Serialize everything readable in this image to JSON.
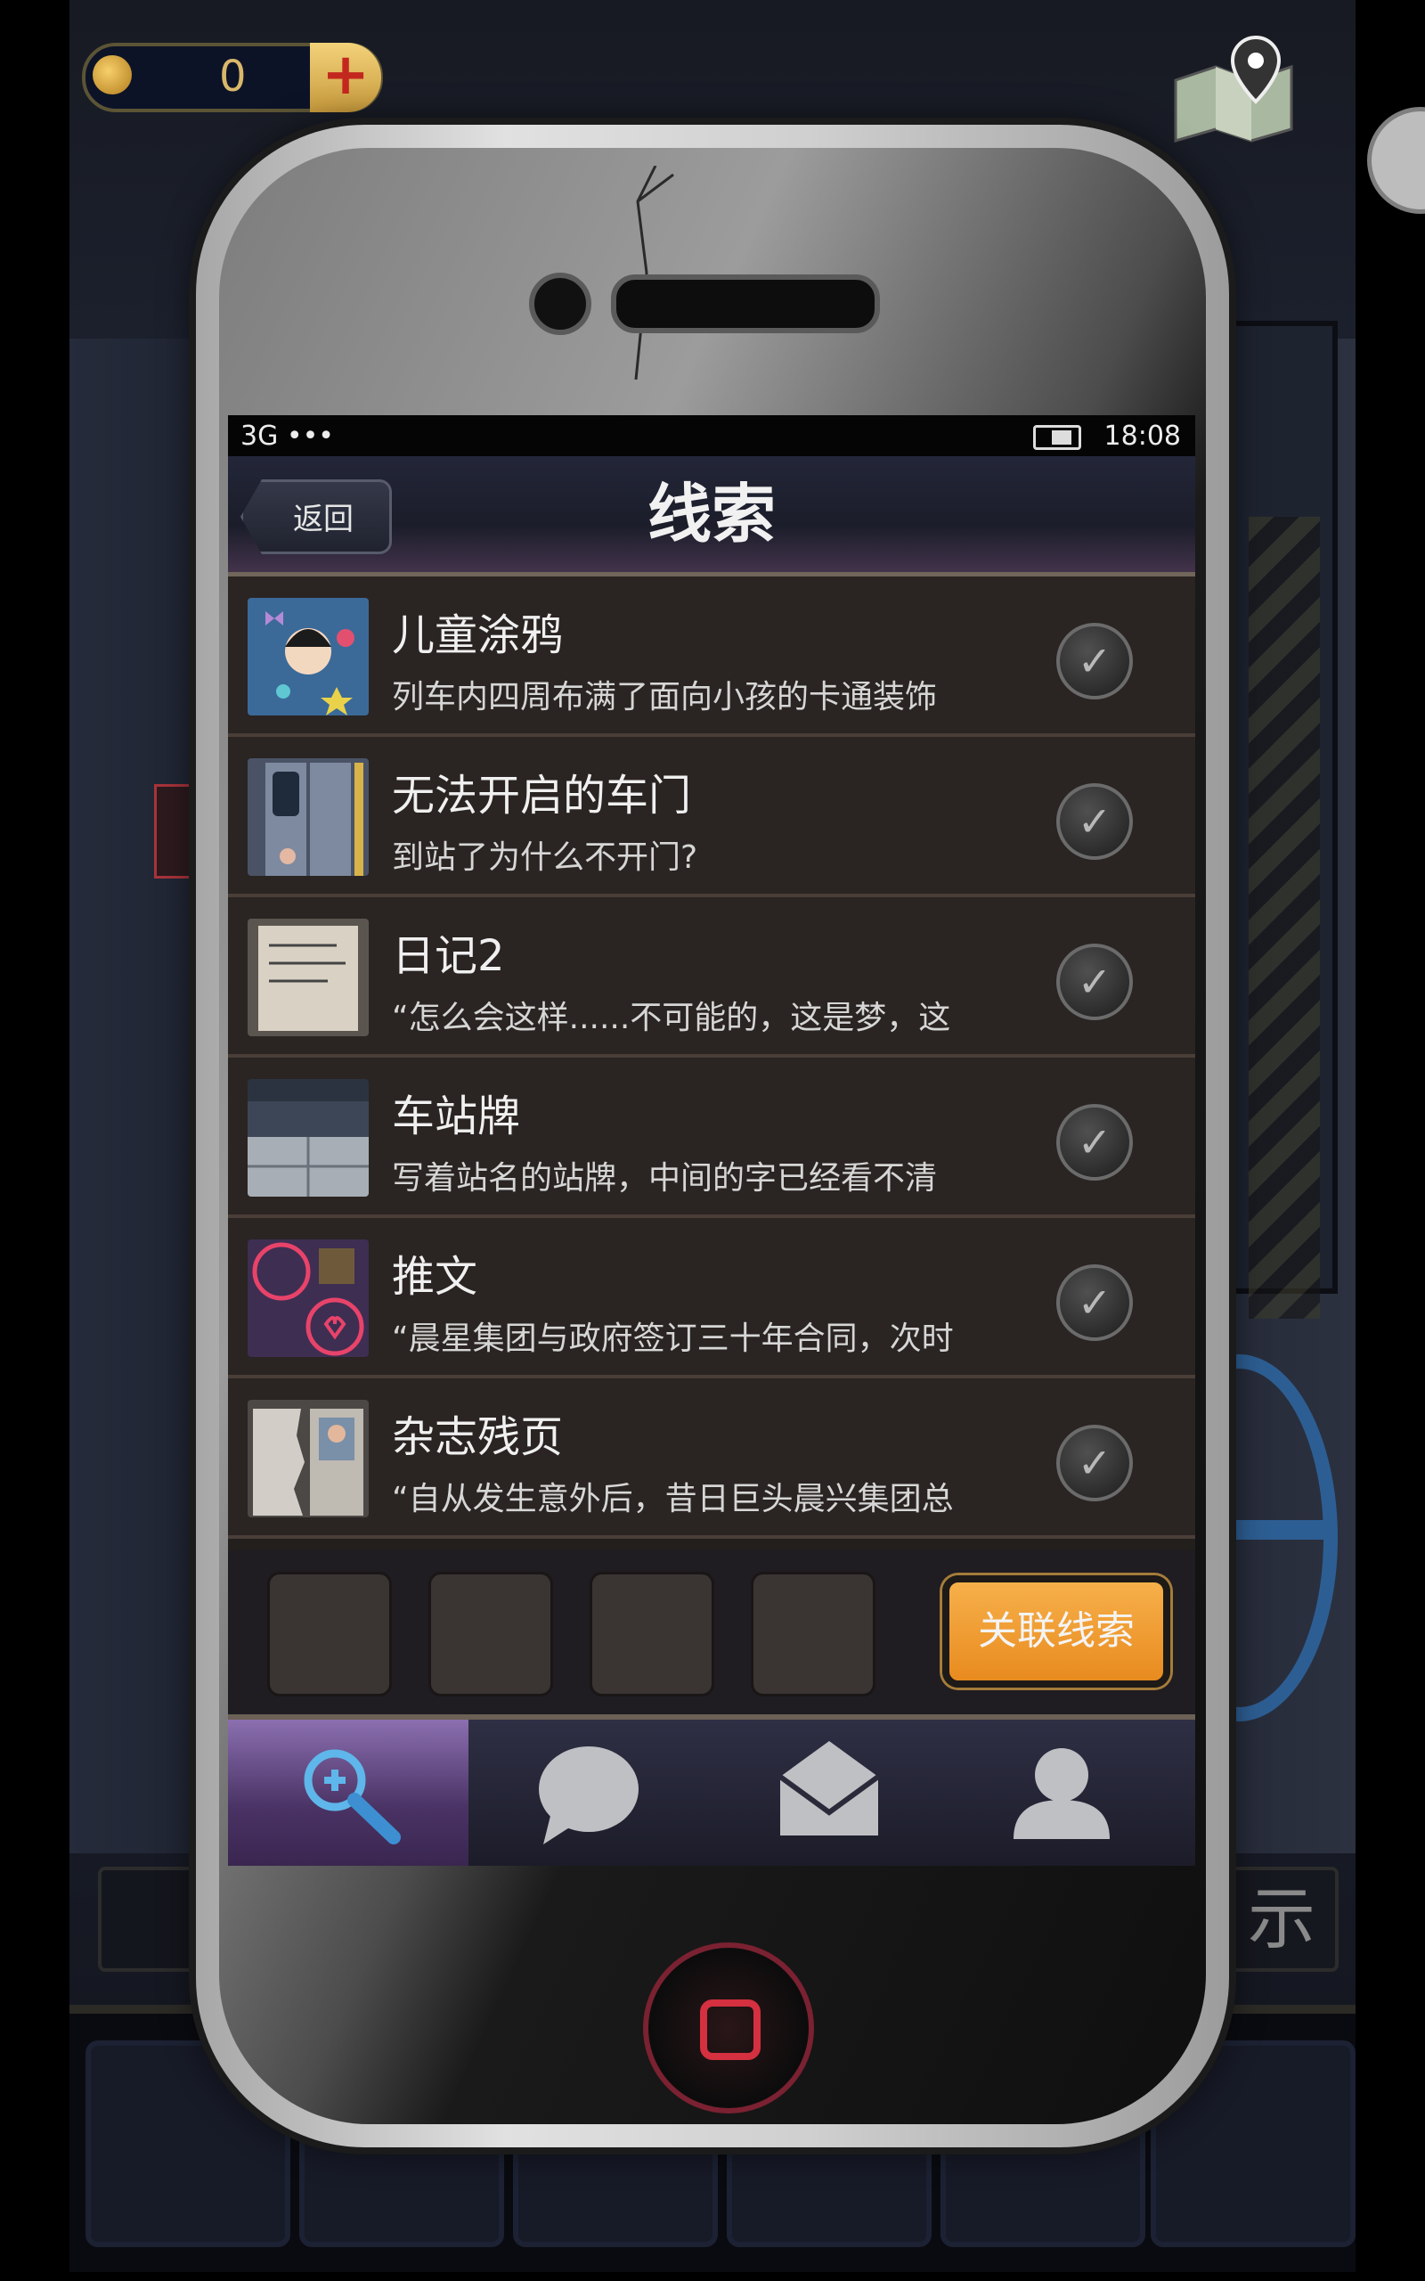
{
  "hud": {
    "coins": "0",
    "add_label": "+",
    "map_icon": "map-pin-icon"
  },
  "background": {
    "hint_right_char": "示"
  },
  "phone": {
    "statusbar": {
      "network": "3G •••",
      "time": "18:08"
    },
    "header": {
      "back_label": "返回",
      "title": "线索"
    },
    "clues": [
      {
        "title": "儿童涂鸦",
        "desc": "列车内四周布满了面向小孩的卡通装饰",
        "thumb": "cartoon-drawing",
        "checked": true
      },
      {
        "title": "无法开启的车门",
        "desc": "到站了为什么不开门?",
        "thumb": "train-door",
        "checked": true
      },
      {
        "title": "日记2",
        "desc": "“怎么会这样......不可能的，这是梦，这",
        "thumb": "diary-page",
        "checked": true
      },
      {
        "title": "车站牌",
        "desc": "写着站名的站牌，中间的字已经看不清",
        "thumb": "station-sign",
        "checked": true
      },
      {
        "title": "推文",
        "desc": "“晨星集团与政府签订三十年合同，次时",
        "thumb": "tweet-neon",
        "checked": true
      },
      {
        "title": "杂志残页",
        "desc": "“自从发生意外后，昔日巨头晨兴集团总",
        "thumb": "magazine-page",
        "checked": true
      }
    ],
    "link_button_label": "关联线索",
    "tabs": [
      {
        "name": "clues",
        "icon": "search-plus-icon",
        "active": true
      },
      {
        "name": "chat",
        "icon": "speech-bubble-icon",
        "active": false
      },
      {
        "name": "mail",
        "icon": "envelope-icon",
        "active": false
      },
      {
        "name": "profile",
        "icon": "user-icon",
        "active": false
      }
    ]
  },
  "colors": {
    "accent_orange": "#e88b1f",
    "tab_active": "#6a4c8f",
    "home_button": "#d43040"
  }
}
